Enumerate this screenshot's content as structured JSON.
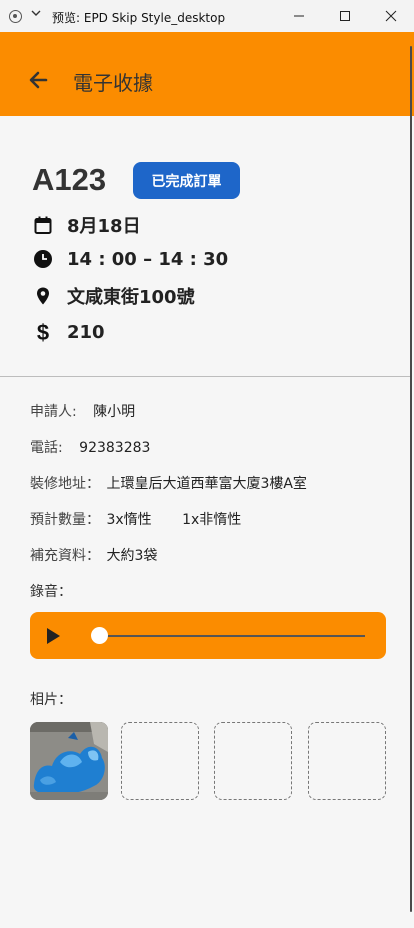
{
  "window": {
    "title": "预览: EPD Skip Style_desktop"
  },
  "appbar": {
    "title": "電子收據"
  },
  "order": {
    "id": "A123",
    "status": "已完成訂單",
    "date": "8月18日",
    "time": "14 : 00 – 14 : 30",
    "address": "文咸東街100號",
    "price": "210"
  },
  "details": {
    "applicant_label": "申請人:",
    "applicant_value": "陳小明",
    "phone_label": "電話:",
    "phone_value": "92383283",
    "reno_label": "裝修地址：",
    "reno_value": "上環皇后大道西華富大廈3樓A室",
    "qty_label": "預計數量：",
    "qty_inert": "3x惰性",
    "qty_noninert": "1x非惰性",
    "extra_label": "補充資料：",
    "extra_value": "大約3袋",
    "recording_label": "錄音：",
    "photos_label": "相片："
  },
  "audio": {
    "progress": 0
  },
  "colors": {
    "accent": "#fb8c00",
    "badge": "#1e66c9",
    "background": "#f6f6f6"
  }
}
